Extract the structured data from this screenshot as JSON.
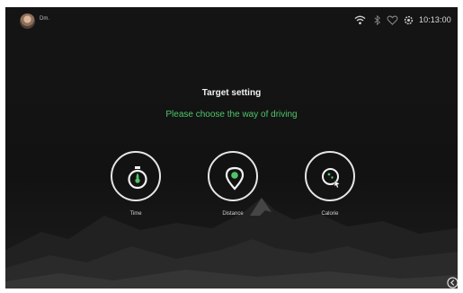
{
  "status_bar": {
    "user_label": "Dm.",
    "time": "10:13:00",
    "icons": [
      "wifi-icon",
      "bluetooth-icon",
      "heart-icon",
      "gear-icon"
    ]
  },
  "main": {
    "title": "Target setting",
    "subtitle": "Please choose the way of driving",
    "options": [
      {
        "label": "Time",
        "icon": "stopwatch-icon"
      },
      {
        "label": "Distance",
        "icon": "location-pin-icon"
      },
      {
        "label": "Calorie",
        "icon": "calorie-icon"
      }
    ]
  },
  "footer": {
    "back_icon": "back-arrow-icon"
  },
  "colors": {
    "accent_green": "#4fc56a",
    "background": "#121212",
    "text": "#f2f2f2"
  }
}
